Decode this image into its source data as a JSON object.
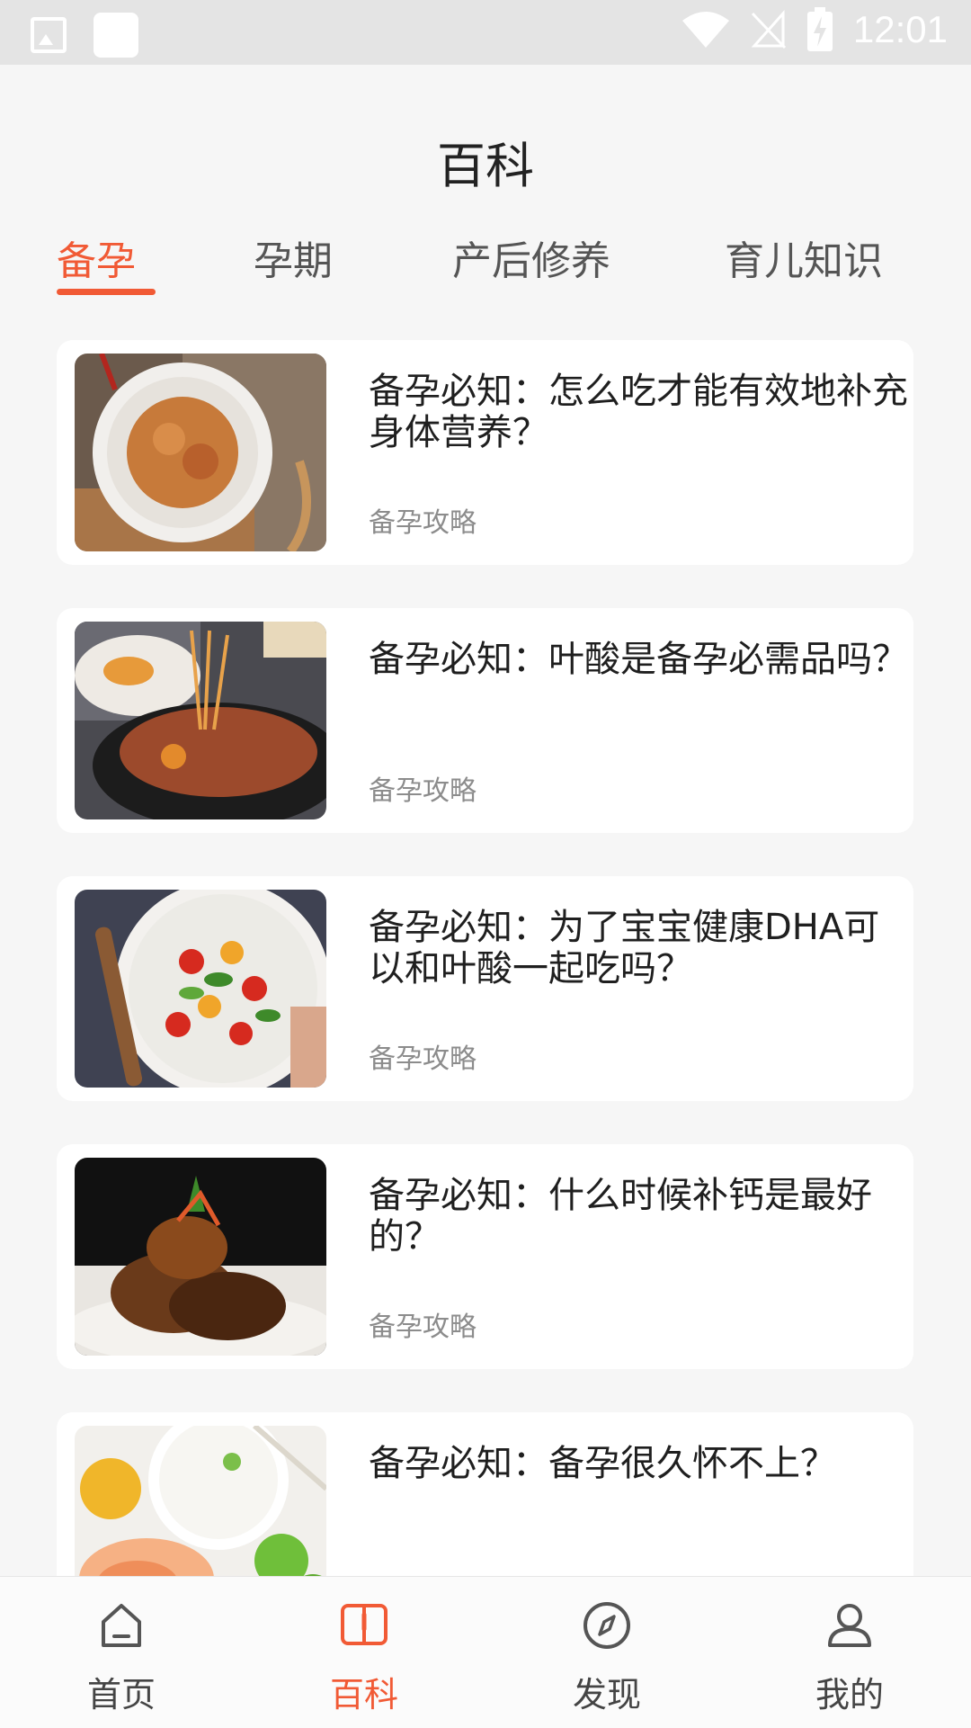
{
  "status_bar": {
    "time": "12:01"
  },
  "header": {
    "title": "百科"
  },
  "tabs": [
    {
      "label": "备孕",
      "active": true
    },
    {
      "label": "孕期",
      "active": false
    },
    {
      "label": "产后修养",
      "active": false
    },
    {
      "label": "育儿知识",
      "active": false
    }
  ],
  "articles": [
    {
      "title": "备孕必知：怎么吃才能有效地补充身体营养？",
      "tag": "备孕攻略",
      "image": "noodle-plate-photo"
    },
    {
      "title": "备孕必知：叶酸是备孕必需品吗？",
      "tag": "备孕攻略",
      "image": "meat-pot-photo"
    },
    {
      "title": "备孕必知：为了宝宝健康DHA可以和叶酸一起吃吗？",
      "tag": "备孕攻略",
      "image": "salad-bowl-photo"
    },
    {
      "title": "备孕必知：什么时候补钙是最好的？",
      "tag": "备孕攻略",
      "image": "chicken-plate-photo"
    },
    {
      "title": "备孕必知：备孕很久怀不上？",
      "tag": "",
      "image": "rice-shrimp-photo"
    }
  ],
  "bottom_nav": [
    {
      "label": "首页",
      "icon": "home-icon",
      "active": false
    },
    {
      "label": "百科",
      "icon": "book-icon",
      "active": true
    },
    {
      "label": "发现",
      "icon": "compass-icon",
      "active": false
    },
    {
      "label": "我的",
      "icon": "user-icon",
      "active": false
    }
  ],
  "colors": {
    "accent": "#f15a35",
    "background": "#f6f6f6",
    "card": "#ffffff",
    "text_primary": "#1f1f1f",
    "text_secondary": "#8c8c8c"
  }
}
